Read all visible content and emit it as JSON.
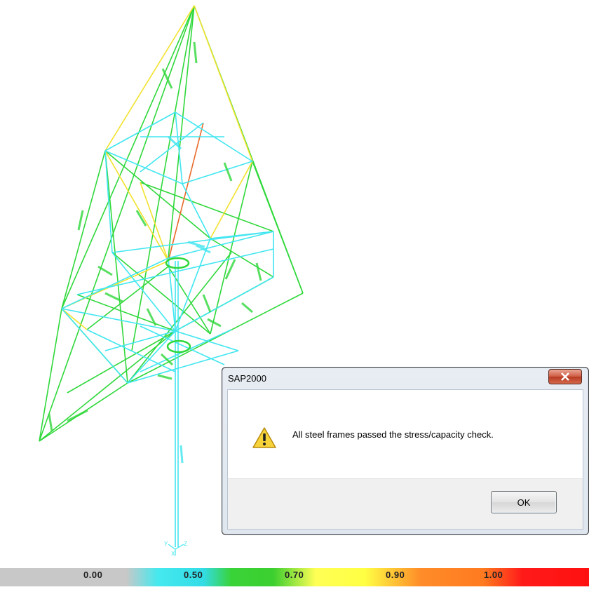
{
  "dialog": {
    "title": "SAP2000",
    "message": "All steel frames passed the stress/capacity check.",
    "ok_label": "OK",
    "icon": "warning-icon",
    "close_icon": "close-icon"
  },
  "legend": {
    "ticks": [
      "0.00",
      "0.50",
      "0.70",
      "0.90",
      "1.00"
    ],
    "colors": [
      "#c8c8c8",
      "#33dce6",
      "#39d338",
      "#ffff55",
      "#ff8c28",
      "#ff1a1a"
    ]
  },
  "model": {
    "member_colors": {
      "cyan": "#41e6f0",
      "green": "#2fd83a",
      "yellow": "#f2e22c",
      "orange": "#e86a2a"
    },
    "axis_labels": [
      "Y",
      "X",
      "Z"
    ]
  }
}
